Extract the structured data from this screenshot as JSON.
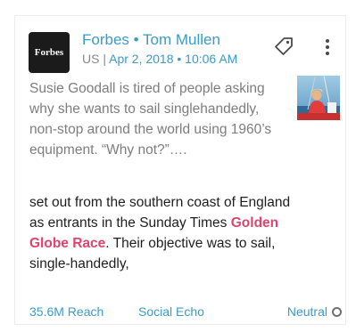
{
  "source": {
    "logo_text": "Forbes",
    "publication": "Forbes",
    "separator": " • ",
    "author": "Tom Mullen",
    "country": "US",
    "meta_separator": " | ",
    "date": "Apr 2, 2018 • 10:06 AM"
  },
  "summary": "Susie Goodall is tired of people asking why she wants to sail singlehandedly, non-stop around the world using 1960’s equipment. “Why not?”….",
  "excerpt": {
    "before": "set out from the southern coast of England as entrants in the Sunday Times ",
    "highlight": "Golden Globe Race",
    "after": ". Their objective was to sail, single-handedly,"
  },
  "footer": {
    "reach": "35.6M Reach",
    "social_echo": "Social Echo",
    "sentiment": "Neutral"
  },
  "icons": {
    "tag": "tag-icon",
    "more": "more-vertical-icon",
    "sentiment": "neutral-circle-icon"
  },
  "colors": {
    "link": "#3a9bc9",
    "highlight": "#e2426b",
    "muted": "#8a8a8a"
  }
}
